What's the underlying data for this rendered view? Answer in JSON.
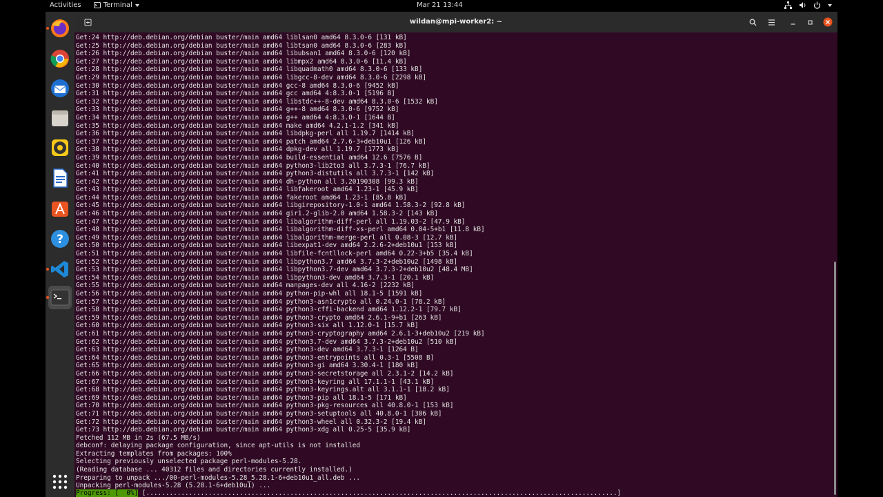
{
  "topbar": {
    "activities": "Activities",
    "app_menu": "Terminal",
    "clock": "Mar 21  13:44"
  },
  "dock": {
    "items": [
      "Firefox",
      "Chrome",
      "Thunderbird",
      "Files",
      "Rhythmbox",
      "LibreOffice Writer",
      "Ubuntu Software",
      "Help",
      "Visual Studio Code",
      "Terminal",
      "Show Applications"
    ]
  },
  "window": {
    "title": "wildan@mpi-worker2: ~"
  },
  "terminal": {
    "lines": [
      "Get:24 http://deb.debian.org/debian buster/main amd64 liblsan0 amd64 8.3.0-6 [131 kB]",
      "Get:25 http://deb.debian.org/debian buster/main amd64 libtsan0 amd64 8.3.0-6 [283 kB]",
      "Get:26 http://deb.debian.org/debian buster/main amd64 libubsan1 amd64 8.3.0-6 [120 kB]",
      "Get:27 http://deb.debian.org/debian buster/main amd64 libmpx2 amd64 8.3.0-6 [11.4 kB]",
      "Get:28 http://deb.debian.org/debian buster/main amd64 libquadmath0 amd64 8.3.0-6 [133 kB]",
      "Get:29 http://deb.debian.org/debian buster/main amd64 libgcc-8-dev amd64 8.3.0-6 [2298 kB]",
      "Get:30 http://deb.debian.org/debian buster/main amd64 gcc-8 amd64 8.3.0-6 [9452 kB]",
      "Get:31 http://deb.debian.org/debian buster/main amd64 gcc amd64 4:8.3.0-1 [5196 B]",
      "Get:32 http://deb.debian.org/debian buster/main amd64 libstdc++-8-dev amd64 8.3.0-6 [1532 kB]",
      "Get:33 http://deb.debian.org/debian buster/main amd64 g++-8 amd64 8.3.0-6 [9752 kB]",
      "Get:34 http://deb.debian.org/debian buster/main amd64 g++ amd64 4:8.3.0-1 [1644 B]",
      "Get:35 http://deb.debian.org/debian buster/main amd64 make amd64 4.2.1-1.2 [341 kB]",
      "Get:36 http://deb.debian.org/debian buster/main amd64 libdpkg-perl all 1.19.7 [1414 kB]",
      "Get:37 http://deb.debian.org/debian buster/main amd64 patch amd64 2.7.6-3+deb10u1 [126 kB]",
      "Get:38 http://deb.debian.org/debian buster/main amd64 dpkg-dev all 1.19.7 [1773 kB]",
      "Get:39 http://deb.debian.org/debian buster/main amd64 build-essential amd64 12.6 [7576 B]",
      "Get:40 http://deb.debian.org/debian buster/main amd64 python3-lib2to3 all 3.7.3-1 [76.7 kB]",
      "Get:41 http://deb.debian.org/debian buster/main amd64 python3-distutils all 3.7.3-1 [142 kB]",
      "Get:42 http://deb.debian.org/debian buster/main amd64 dh-python all 3.20190308 [99.3 kB]",
      "Get:43 http://deb.debian.org/debian buster/main amd64 libfakeroot amd64 1.23-1 [45.9 kB]",
      "Get:44 http://deb.debian.org/debian buster/main amd64 fakeroot amd64 1.23-1 [85.8 kB]",
      "Get:45 http://deb.debian.org/debian buster/main amd64 libgirepository-1.0-1 amd64 1.58.3-2 [92.8 kB]",
      "Get:46 http://deb.debian.org/debian buster/main amd64 gir1.2-glib-2.0 amd64 1.58.3-2 [143 kB]",
      "Get:47 http://deb.debian.org/debian buster/main amd64 libalgorithm-diff-perl all 1.19.03-2 [47.9 kB]",
      "Get:48 http://deb.debian.org/debian buster/main amd64 libalgorithm-diff-xs-perl amd64 0.04-5+b1 [11.8 kB]",
      "Get:49 http://deb.debian.org/debian buster/main amd64 libalgorithm-merge-perl all 0.08-3 [12.7 kB]",
      "Get:50 http://deb.debian.org/debian buster/main amd64 libexpat1-dev amd64 2.2.6-2+deb10u1 [153 kB]",
      "Get:51 http://deb.debian.org/debian buster/main amd64 libfile-fcntllock-perl amd64 0.22-3+b5 [35.4 kB]",
      "Get:52 http://deb.debian.org/debian buster/main amd64 libpython3.7 amd64 3.7.3-2+deb10u2 [1498 kB]",
      "Get:53 http://deb.debian.org/debian buster/main amd64 libpython3.7-dev amd64 3.7.3-2+deb10u2 [48.4 MB]",
      "Get:54 http://deb.debian.org/debian buster/main amd64 libpython3-dev amd64 3.7.3-1 [20.1 kB]",
      "Get:55 http://deb.debian.org/debian buster/main amd64 manpages-dev all 4.16-2 [2232 kB]",
      "Get:56 http://deb.debian.org/debian buster/main amd64 python-pip-whl all 18.1-5 [1591 kB]",
      "Get:57 http://deb.debian.org/debian buster/main amd64 python3-asn1crypto all 0.24.0-1 [78.2 kB]",
      "Get:58 http://deb.debian.org/debian buster/main amd64 python3-cffi-backend amd64 1.12.2-1 [79.7 kB]",
      "Get:59 http://deb.debian.org/debian buster/main amd64 python3-crypto amd64 2.6.1-9+b1 [263 kB]",
      "Get:60 http://deb.debian.org/debian buster/main amd64 python3-six all 1.12.0-1 [15.7 kB]",
      "Get:61 http://deb.debian.org/debian buster/main amd64 python3-cryptography amd64 2.6.1-3+deb10u2 [219 kB]",
      "Get:62 http://deb.debian.org/debian buster/main amd64 python3.7-dev amd64 3.7.3-2+deb10u2 [510 kB]",
      "Get:63 http://deb.debian.org/debian buster/main amd64 python3-dev amd64 3.7.3-1 [1264 B]",
      "Get:64 http://deb.debian.org/debian buster/main amd64 python3-entrypoints all 0.3-1 [5508 B]",
      "Get:65 http://deb.debian.org/debian buster/main amd64 python3-gi amd64 3.30.4-1 [180 kB]",
      "Get:66 http://deb.debian.org/debian buster/main amd64 python3-secretstorage all 2.3.1-2 [14.2 kB]",
      "Get:67 http://deb.debian.org/debian buster/main amd64 python3-keyring all 17.1.1-1 [43.1 kB]",
      "Get:68 http://deb.debian.org/debian buster/main amd64 python3-keyrings.alt all 3.1.1-1 [18.2 kB]",
      "Get:69 http://deb.debian.org/debian buster/main amd64 python3-pip all 18.1-5 [171 kB]",
      "Get:70 http://deb.debian.org/debian buster/main amd64 python3-pkg-resources all 40.8.0-1 [153 kB]",
      "Get:71 http://deb.debian.org/debian buster/main amd64 python3-setuptools all 40.8.0-1 [306 kB]",
      "Get:72 http://deb.debian.org/debian buster/main amd64 python3-wheel all 0.32.3-2 [19.4 kB]",
      "Get:73 http://deb.debian.org/debian buster/main amd64 python3-xdg all 0.25-5 [35.9 kB]",
      "Fetched 112 MB in 2s (67.5 MB/s)",
      "debconf: delaying package configuration, since apt-utils is not installed",
      "Extracting templates from packages: 100%",
      "Selecting previously unselected package perl-modules-5.28.",
      "(Reading database ... 40312 files and directories currently installed.)",
      "Preparing to unpack .../00-perl-modules-5.28_5.28.1-6+deb10u1_all.deb ...",
      "Unpacking perl-modules-5.28 (5.28.1-6+deb10u1) ..."
    ],
    "progress_label": "Progress: [  0%]",
    "progress_bar": " [.........................................................................................................................]"
  },
  "colors": {
    "terminal_bg": "#300a24",
    "progress_green": "#4e9a06",
    "accent": "#e95420"
  }
}
